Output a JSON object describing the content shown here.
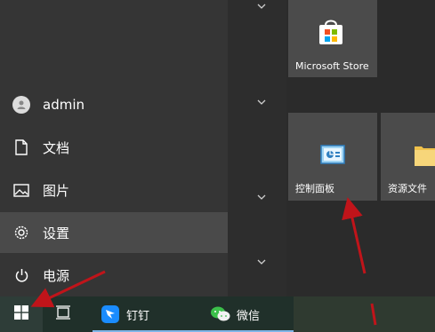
{
  "start_menu": {
    "user": {
      "label": "admin",
      "icon": "user-avatar-icon"
    },
    "rail": [
      {
        "label": "文档",
        "icon": "document-icon"
      },
      {
        "label": "图片",
        "icon": "picture-icon"
      },
      {
        "label": "设置",
        "icon": "gear-icon"
      },
      {
        "label": "电源",
        "icon": "power-icon"
      }
    ],
    "tiles": [
      {
        "label": "Microsoft Store",
        "icon": "store-icon"
      },
      {
        "label": "控制面板",
        "icon": "control-panel-icon"
      },
      {
        "label": "资源文件",
        "icon": "folder-icon"
      }
    ]
  },
  "taskbar": {
    "start_icon": "windows-logo-icon",
    "taskview_icon": "task-view-icon",
    "apps": [
      {
        "label": "钉钉",
        "icon": "dingtalk-icon"
      },
      {
        "label": "微信",
        "icon": "wechat-icon"
      }
    ]
  },
  "colors": {
    "annotation_arrow": "#c0141a",
    "active_underline": "#7fb6e8",
    "tile_bg": "#4b4b4b"
  }
}
